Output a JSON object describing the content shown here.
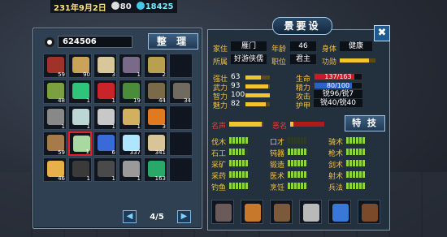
{
  "topbar": {
    "date": "231年9月2日",
    "pearl": "80",
    "coin": "18425"
  },
  "inventory": {
    "money": "624506",
    "sort_label": "整 理",
    "page": "4/5",
    "prev_icon": "left-arrow-icon",
    "next_icon": "right-arrow-icon",
    "slots": [
      {
        "name": "wood-icon",
        "color": "#a0322a",
        "count": "59"
      },
      {
        "name": "scroll-icon",
        "color": "#c9a35a",
        "count": "90"
      },
      {
        "name": "scroll-paper-icon",
        "color": "#d8c79a",
        "count": "3"
      },
      {
        "name": "armor-icon",
        "color": "#7a6a8a",
        "count": "1"
      },
      {
        "name": "axe-icon",
        "color": "#b8a050",
        "count": "2"
      },
      {
        "name": "empty-slot",
        "color": "",
        "count": ""
      },
      {
        "name": "jar-icon",
        "color": "#7aa040",
        "count": "48"
      },
      {
        "name": "green-ring-icon",
        "color": "#2ec57a",
        "count": "1"
      },
      {
        "name": "fruit-icon",
        "color": "#c8242a",
        "count": "1"
      },
      {
        "name": "herb-icon",
        "color": "#4a8c3a",
        "count": "19"
      },
      {
        "name": "box-icon",
        "color": "#7a6a4a",
        "count": "44"
      },
      {
        "name": "stone-icon",
        "color": "#706a60",
        "count": "34"
      },
      {
        "name": "spear-icon",
        "color": "#888888",
        "count": "1"
      },
      {
        "name": "jade-ring-icon",
        "color": "#bcd6d6",
        "count": "1"
      },
      {
        "name": "silver-ring-icon",
        "color": "#c8c8c8",
        "count": "1"
      },
      {
        "name": "book-icon",
        "color": "#d2b060",
        "count": "1"
      },
      {
        "name": "gourd-icon",
        "color": "#e07a20",
        "count": "3"
      },
      {
        "name": "empty-slot",
        "color": "",
        "count": ""
      },
      {
        "name": "logs-icon",
        "color": "#a67a4a",
        "count": "59"
      },
      {
        "name": "jade-seal-icon",
        "color": "#a9d8a0",
        "count": "1"
      },
      {
        "name": "blue-orb-icon",
        "color": "#3a6ad8",
        "count": "6"
      },
      {
        "name": "crystal-icon",
        "color": "#aee6ff",
        "count": "337"
      },
      {
        "name": "bottle-icon",
        "color": "#d9c49a",
        "count": "341"
      },
      {
        "name": "empty-slot",
        "color": "",
        "count": ""
      },
      {
        "name": "mystery-icon",
        "color": "#e8b04a",
        "count": "46"
      },
      {
        "name": "horse-icon",
        "color": "#3a3a3a",
        "count": "1"
      },
      {
        "name": "sword-icon",
        "color": "#4a4a4a",
        "count": "1"
      },
      {
        "name": "halberd-icon",
        "color": "#9a9a9a",
        "count": "1"
      },
      {
        "name": "boots-icon",
        "color": "#2aa86a",
        "count": "163"
      },
      {
        "name": "empty-slot",
        "color": "",
        "count": ""
      }
    ]
  },
  "character": {
    "title": "景要设",
    "close_icon": "close-icon",
    "home_label": "家住",
    "home_value": "雁门",
    "age_label": "年龄",
    "age_value": "46",
    "body_label": "身体",
    "body_value": "健康",
    "belong_label": "所属",
    "belong_value": "好游侠儒",
    "rank_label": "职位",
    "rank_value": "君主",
    "merit_label": "功勋",
    "merit_level": 0.82,
    "stats": [
      {
        "label": "强壮",
        "value": "63",
        "level": 0.63
      },
      {
        "label": "武力",
        "value": "93",
        "level": 0.93
      },
      {
        "label": "智力",
        "value": "100",
        "level": 1.0
      },
      {
        "label": "魅力",
        "value": "82",
        "level": 0.82
      }
    ],
    "life_label": "生命",
    "life_value": "137/163",
    "life_level": 0.84,
    "energy_label": "精力",
    "energy_value": "80/100",
    "energy_level": 0.8,
    "attack_label": "攻击",
    "attack_value": "锐96/锐7",
    "armor_label": "护甲",
    "armor_value": "锐40/锐40",
    "fame_label": "名声",
    "fame_level": 0.95,
    "notoriety_label": "恶名",
    "notoriety_level": 0.1,
    "special_label": "特 技",
    "skills": [
      {
        "label": "伐木",
        "level": 6
      },
      {
        "label": "口才",
        "level": 0
      },
      {
        "label": "骑术",
        "level": 6
      },
      {
        "label": "石工",
        "level": 5
      },
      {
        "label": "钝器",
        "level": 6
      },
      {
        "label": "枪术",
        "level": 6
      },
      {
        "label": "采矿",
        "level": 6
      },
      {
        "label": "锻造",
        "level": 6
      },
      {
        "label": "剑术",
        "level": 6
      },
      {
        "label": "采药",
        "level": 6
      },
      {
        "label": "医术",
        "level": 6
      },
      {
        "label": "射术",
        "level": 6
      },
      {
        "label": "钓鱼",
        "level": 6
      },
      {
        "label": "烹饪",
        "level": 6
      },
      {
        "label": "兵法",
        "level": 6
      }
    ],
    "equipment": [
      {
        "name": "armor-equip-icon",
        "color": "#6a5a5a"
      },
      {
        "name": "saber-equip-icon",
        "color": "#c8782a"
      },
      {
        "name": "mace-equip-icon",
        "color": "#7a5a3a"
      },
      {
        "name": "helmet-equip-icon",
        "color": "#b9b9b9"
      },
      {
        "name": "blade-equip-icon",
        "color": "#3a78d8"
      },
      {
        "name": "horse-equip-icon",
        "color": "#7a4a2a"
      }
    ]
  }
}
